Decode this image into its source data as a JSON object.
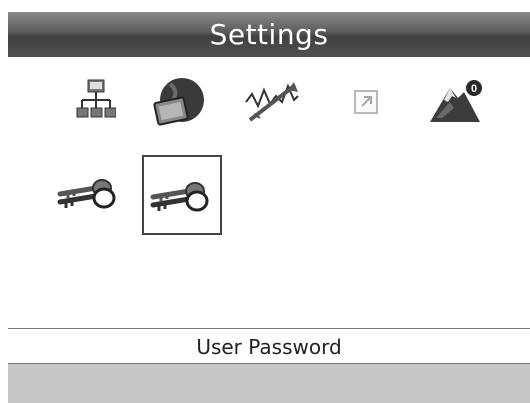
{
  "header": {
    "title": "Settings"
  },
  "icons": [
    {
      "name": "network-icon"
    },
    {
      "name": "globe-screen-icon"
    },
    {
      "name": "signal-analyzer-icon"
    },
    {
      "name": "shortcut-arrow-icon"
    },
    {
      "name": "mountain-alert-icon",
      "badge": "0"
    },
    {
      "name": "keys-icon"
    },
    {
      "name": "keys-icon",
      "selected": true
    }
  ],
  "status": {
    "label": "User Password"
  }
}
